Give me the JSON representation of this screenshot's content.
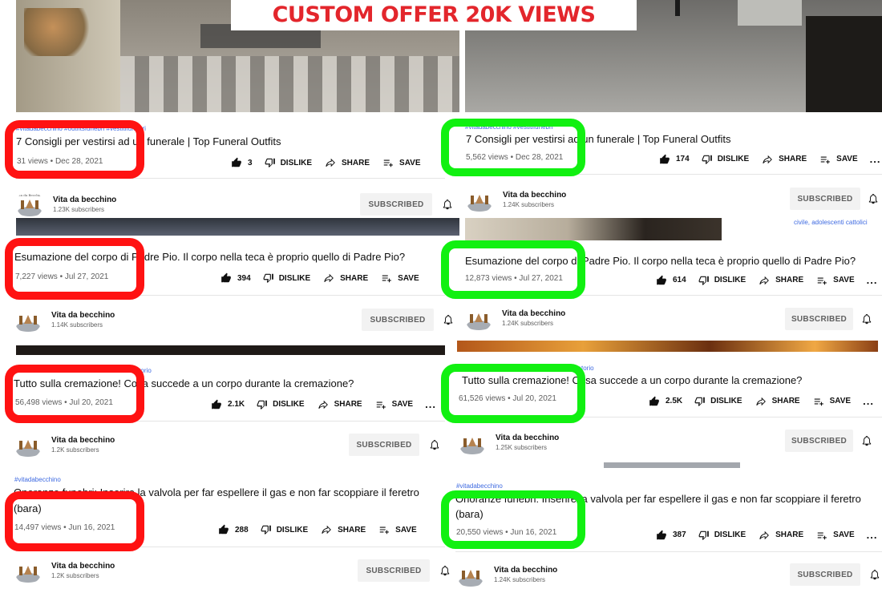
{
  "banner": {
    "text": "CUSTOM OFFER 20K VIEWS"
  },
  "colors": {
    "before_ring": "#ff1212",
    "after_ring": "#11f011",
    "hashtag": "#3e6ae1"
  },
  "icons": [
    "thumb-up-icon",
    "thumb-down-icon",
    "share-icon",
    "playlist-add-icon",
    "bell-icon",
    "more-icon"
  ],
  "labels": {
    "dislike": "DISLIKE",
    "share": "SHARE",
    "save": "SAVE",
    "subscribed": "SUBSCRIBED",
    "more": "...",
    "channel": "Vita da becchino"
  },
  "side_note": "civile, adolescenti cattolici",
  "before": [
    {
      "tags": "#vitadabecchino #outfitsfunebri #vestitifunebri",
      "title": "7 Consigli per vestirsi ad un funerale | Top Funeral Outfits",
      "views": "31 views • Dec 28, 2021",
      "likes": "3",
      "subs": "1.23K subscribers"
    },
    {
      "tags": "",
      "title": "Esumazione del corpo di Padre Pio. Il corpo nella teca è proprio quello di Padre Pio?",
      "views": "7,227 views • Jul 27, 2021",
      "likes": "394",
      "subs": "1.14K subscribers"
    },
    {
      "tags": "#vitadabecchino #cremazione #forno crematorio",
      "title": "Tutto sulla cremazione! Cosa succede a un corpo durante la cremazione?",
      "views": "56,498 views • Jul 20, 2021",
      "likes": "2.1K",
      "subs": "1.2K subscribers"
    },
    {
      "tags": "#vitadabecchino",
      "title": "Onoranze funebri: Inserire la valvola per far espellere il gas e non far scoppiare il feretro",
      "title2": "(bara)",
      "views": "14,497 views • Jun 16, 2021",
      "likes": "288",
      "subs": "1.2K subscribers"
    }
  ],
  "after": [
    {
      "tags": "#vitadabecchino #vestitifunebri",
      "title": "7 Consigli per vestirsi ad un funerale | Top Funeral Outfits",
      "views": "5,562 views • Dec 28, 2021",
      "likes": "174",
      "subs": "1.24K subscribers"
    },
    {
      "tags": "",
      "title": "Esumazione del corpo di Padre Pio. Il corpo nella teca è proprio quello di Padre Pio?",
      "views": "12,873 views • Jul 27, 2021",
      "likes": "614",
      "subs": "1.24K subscribers"
    },
    {
      "tags": "#vitadabecchino #cremazione #fornocrematorio",
      "title": "Tutto sulla cremazione! Cosa succede a un corpo durante la cremazione?",
      "views": "61,526 views • Jul 20, 2021",
      "likes": "2.5K",
      "subs": "1.25K subscribers"
    },
    {
      "tags": "#vitadabecchino",
      "title": "Onoranze funebri: Inserire la valvola per far espellere il gas e non far scoppiare il feretro",
      "title2": "(bara)",
      "views": "20,550 views • Jun 16, 2021",
      "likes": "387",
      "subs": "1.24K subscribers"
    }
  ]
}
